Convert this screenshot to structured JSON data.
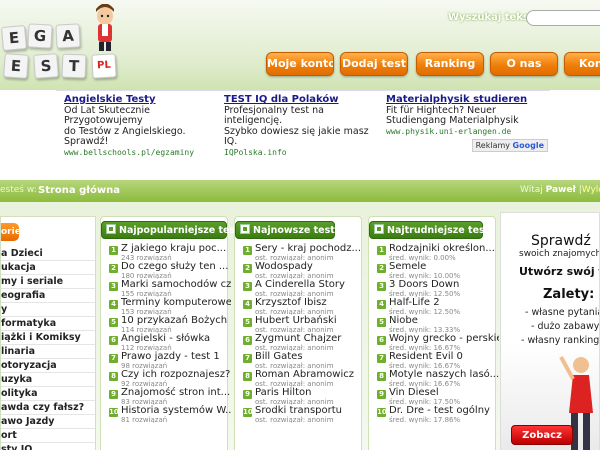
{
  "header": {
    "logo_tiles": [
      "E",
      "G",
      "A",
      "E",
      "S",
      "T",
      "PL"
    ],
    "search_label": "Wyszukaj tekst:",
    "search_value": "",
    "nav": [
      "Moje konto",
      "Dodaj test",
      "Ranking",
      "O nas",
      "Kon"
    ]
  },
  "ads": [
    {
      "title": "Angielskie Testy",
      "line1": "Od Lat Skutecznie Przygotowujemy",
      "line2": "do Testów z Angielskiego.",
      "line3": "Sprawdź!",
      "url": "www.bellschools.pl/egzaminy"
    },
    {
      "title": "TEST IQ dla Polaków",
      "line1": "Profesjonalny test na inteligencję.",
      "line2": "Szybko dowiesz się jakie masz IQ.",
      "line3": "",
      "url": "IQPolska.info"
    },
    {
      "title": "Materialphysik studieren",
      "line1": "Fit für Hightech? Neuer",
      "line2": "Studiengang Materialphysik",
      "line3": "",
      "url": "www.physik.uni-erlangen.de"
    }
  ],
  "ads_google": {
    "prefix": "Reklamy",
    "brand": "Google"
  },
  "breadcrumb": {
    "prefix": "esteś w:",
    "current": "Strona główna"
  },
  "welcome": {
    "text": "Witaj",
    "user": "Paweł",
    "sep": "|",
    "logout": "Wylog"
  },
  "categories": {
    "header": "orie",
    "items": [
      "a Dzieci",
      "ukacja",
      "my i seriale",
      "eografia",
      "y",
      "formatyka",
      "iążki i Komiksy",
      "linaria",
      "otoryzacja",
      "uzyka",
      "olityka",
      "awda czy fałsz?",
      "awo Jazdy",
      "ort",
      "sty IQ"
    ]
  },
  "columns": [
    {
      "title": "Najpopularniejsze testy",
      "items": [
        {
          "n": "1",
          "title": "Z jakiego kraju poc...",
          "sub": "243 rozwiązań"
        },
        {
          "n": "2",
          "title": "Do czego służy ten ...",
          "sub": "180 rozwiązań"
        },
        {
          "n": "3",
          "title": "Marki samochodów cz. 1",
          "sub": "155 rozwiązań"
        },
        {
          "n": "4",
          "title": "Terminy komputerowe",
          "sub": "153 rozwiązań"
        },
        {
          "n": "5",
          "title": "10 przykazań Bożych",
          "sub": "114 rozwiązań"
        },
        {
          "n": "6",
          "title": "Angielski - słówka",
          "sub": "112 rozwiązań"
        },
        {
          "n": "7",
          "title": "Prawo jazdy - test 1",
          "sub": "98 rozwiązań"
        },
        {
          "n": "8",
          "title": "Czy ich rozpoznajesz?",
          "sub": "92 rozwiązań"
        },
        {
          "n": "9",
          "title": "Znajomość stron int...",
          "sub": "83 rozwiązań"
        },
        {
          "n": "10",
          "title": "Historia systemów W...",
          "sub": "81 rozwiązań"
        }
      ]
    },
    {
      "title": "Najnowsze testy",
      "items": [
        {
          "n": "1",
          "title": "Sery - kraj pochodz...",
          "sub": "ost. rozwiązał: anonim"
        },
        {
          "n": "2",
          "title": "Wodospady",
          "sub": "ost. rozwiązał: anonim"
        },
        {
          "n": "3",
          "title": "A Cinderella Story",
          "sub": "ost. rozwiązał: anonim"
        },
        {
          "n": "4",
          "title": "Krzysztof Ibisz",
          "sub": "ost. rozwiązał: anonim"
        },
        {
          "n": "5",
          "title": "Hubert Urbański",
          "sub": "ost. rozwiązał: anonim"
        },
        {
          "n": "6",
          "title": "Zygmunt Chajzer",
          "sub": "ost. rozwiązał: anonim"
        },
        {
          "n": "7",
          "title": "Bill Gates",
          "sub": "ost. rozwiązał: anonim"
        },
        {
          "n": "8",
          "title": "Roman Abramowicz",
          "sub": "ost. rozwiązał: anonim"
        },
        {
          "n": "9",
          "title": "Paris Hilton",
          "sub": "ost. rozwiązał: anonim"
        },
        {
          "n": "10",
          "title": "Środki transportu",
          "sub": "ost. rozwiązał: anonim"
        }
      ]
    },
    {
      "title": "Najtrudniejsze testy",
      "items": [
        {
          "n": "1",
          "title": "Rodzajniki określon...",
          "sub": "śred. wynik: 0.00%"
        },
        {
          "n": "2",
          "title": "Semele",
          "sub": "śred. wynik: 10.00%"
        },
        {
          "n": "3",
          "title": "3 Doors Down",
          "sub": "śred. wynik: 12.50%"
        },
        {
          "n": "4",
          "title": "Half-Life 2",
          "sub": "śred. wynik: 12.50%"
        },
        {
          "n": "5",
          "title": "Niobe",
          "sub": "śred. wynik: 13.33%"
        },
        {
          "n": "6",
          "title": "Wojny grecko - perskie",
          "sub": "śred. wynik: 16.67%"
        },
        {
          "n": "7",
          "title": "Resident Evil 0",
          "sub": "śred. wynik: 16.67%"
        },
        {
          "n": "8",
          "title": "Motyle naszych lasó...",
          "sub": "śred. wynik: 16.67%"
        },
        {
          "n": "9",
          "title": "Vin Diesel",
          "sub": "śred. wynik: 17.50%"
        },
        {
          "n": "10",
          "title": "Dr. Dre - test ogólny",
          "sub": "śred. wynik: 17.86%"
        }
      ]
    }
  ],
  "promo": {
    "title": "Sprawdź",
    "sub": "swoich znajomych",
    "create": "Utwórz swój test",
    "benefits_title": "Zalety:",
    "benefits": [
      "- własne pytania",
      "- dużo zabawy",
      "- własny ranking"
    ],
    "button": "Zobacz"
  },
  "colors": {
    "accent_green": "#5a9e2a",
    "nav_orange": "#f07f0a",
    "promo_red": "#cc0000"
  }
}
